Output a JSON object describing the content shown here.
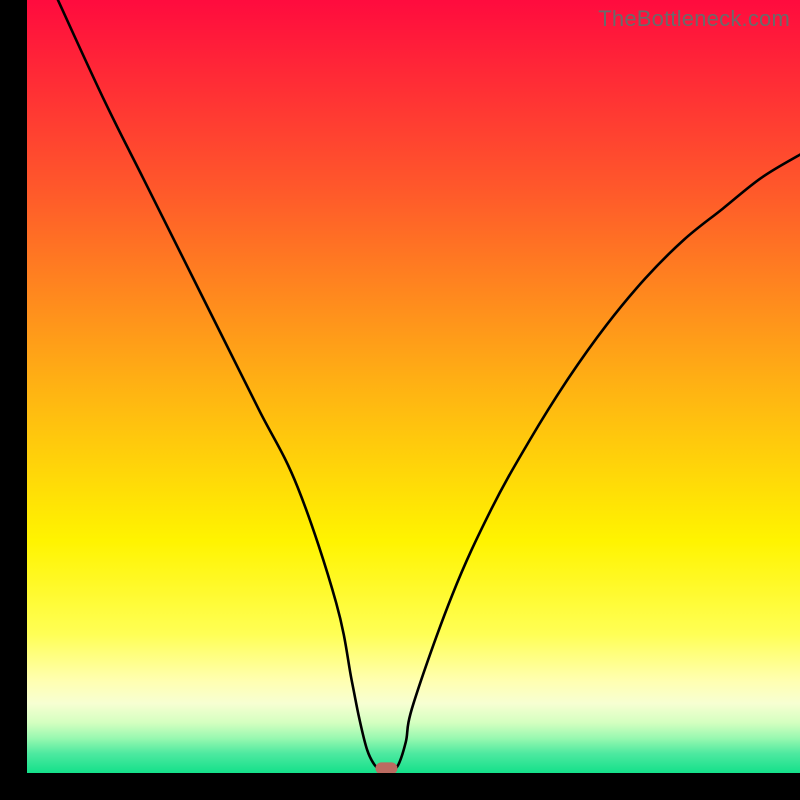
{
  "watermark": "TheBottleneck.com",
  "chart_data": {
    "type": "line",
    "title": "",
    "xlabel": "",
    "ylabel": "",
    "xlim": [
      0,
      100
    ],
    "ylim": [
      0,
      100
    ],
    "x": [
      4,
      10,
      15,
      20,
      25,
      30,
      35,
      40,
      42,
      43,
      44,
      45,
      46,
      47,
      48,
      49,
      50,
      55,
      60,
      65,
      70,
      75,
      80,
      85,
      90,
      95,
      100
    ],
    "values": [
      100,
      87,
      77,
      67,
      57,
      47,
      37,
      22,
      12,
      7,
      3,
      1,
      0.3,
      0.3,
      1,
      4,
      9,
      23,
      34,
      43,
      51,
      58,
      64,
      69,
      73,
      77,
      80
    ],
    "marker": {
      "x": 46.5,
      "y": 0.6,
      "color": "#bb6b61"
    },
    "background": {
      "type": "vertical-gradient",
      "stops": [
        {
          "pos": 0.0,
          "color": "#ff0b3e"
        },
        {
          "pos": 0.25,
          "color": "#ff5a2a"
        },
        {
          "pos": 0.5,
          "color": "#ffb213"
        },
        {
          "pos": 0.7,
          "color": "#fff400"
        },
        {
          "pos": 0.82,
          "color": "#ffff55"
        },
        {
          "pos": 0.88,
          "color": "#ffffb0"
        },
        {
          "pos": 0.91,
          "color": "#f7ffd2"
        },
        {
          "pos": 0.935,
          "color": "#d4ffc0"
        },
        {
          "pos": 0.955,
          "color": "#98f8b0"
        },
        {
          "pos": 0.975,
          "color": "#4de9a0"
        },
        {
          "pos": 1.0,
          "color": "#14e08a"
        }
      ]
    },
    "axes": {
      "left_width": 27,
      "bottom_height": 27,
      "color": "#000000"
    }
  }
}
